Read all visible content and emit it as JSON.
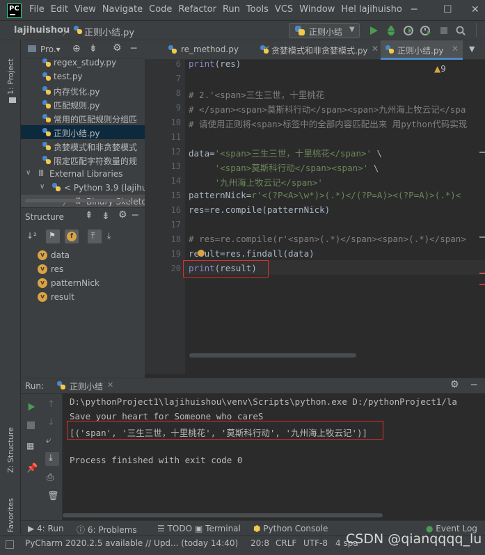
{
  "window": {
    "menu": [
      "File",
      "Edit",
      "View",
      "Navigate",
      "Code",
      "Refactor",
      "Run",
      "Tools",
      "VCS",
      "Window",
      "Hel"
    ],
    "project_title": "lajihuisho"
  },
  "navbar": {
    "project": "lajihuishou",
    "file": "正则小结.py",
    "run_config": "正则小结"
  },
  "left_strip": {
    "project_tab": "1: Project",
    "structure_tab": "Z: Structure",
    "favorites_tab": "2: Favorites"
  },
  "project_panel": {
    "header": "Pro.▾",
    "items": [
      {
        "label": "regex_study.py",
        "indent": 77
      },
      {
        "label": "test.py",
        "indent": 77
      },
      {
        "label": "内存优化.py",
        "indent": 77
      },
      {
        "label": "匹配规则.py",
        "indent": 77
      },
      {
        "label": "常用的匹配规则分组匹",
        "indent": 77
      },
      {
        "label": "正则小结.py",
        "indent": 77,
        "selected": true
      },
      {
        "label": "贪婪模式和非贪婪模式",
        "indent": 77
      },
      {
        "label": "限定匹配字符数量的规",
        "indent": 77
      },
      {
        "label": "External Libraries",
        "indent": 55
      },
      {
        "label": "< Python 3.9 (lajihuis",
        "indent": 75
      },
      {
        "label": "Binary Skeletons",
        "indent": 108
      }
    ]
  },
  "structure_panel": {
    "header": "Structure",
    "items": [
      "data",
      "res",
      "patternNick",
      "result"
    ]
  },
  "editor": {
    "tabs": [
      "re_method.py",
      "贪婪模式和非贪婪模式.py",
      "正则小结.py"
    ],
    "inspection_count": "9",
    "lines": [
      {
        "n": "6",
        "parts": [
          [
            "kw",
            "print"
          ],
          [
            "fn",
            "(res)"
          ]
        ]
      },
      {
        "n": "7",
        "parts": []
      },
      {
        "n": "8",
        "parts": [
          [
            "cm",
            "# 2.'<span>三生三世，十里桃花"
          ]
        ]
      },
      {
        "n": "9",
        "parts": [
          [
            "cm",
            "# </span><span>莫斯科行动</span><span>九州海上牧云记</spa"
          ]
        ]
      },
      {
        "n": "10",
        "parts": [
          [
            "cm",
            "# 请使用正则将<span>标签中的全部内容匹配出来 用python代码实现"
          ]
        ]
      },
      {
        "n": "11",
        "parts": []
      },
      {
        "n": "12",
        "parts": [
          [
            "fn",
            "data="
          ],
          [
            "str",
            "'<span>三生三世，十里桃花</span>'"
          ],
          [
            "fn",
            " \\"
          ]
        ]
      },
      {
        "n": "13",
        "parts": [
          [
            "str",
            "     '<span>莫斯科行动</span><span>'"
          ],
          [
            "fn",
            " \\"
          ]
        ]
      },
      {
        "n": "14",
        "parts": [
          [
            "str",
            "     '九州海上牧云记</span>'"
          ]
        ]
      },
      {
        "n": "15",
        "parts": [
          [
            "fn",
            "patternNick="
          ],
          [
            "str",
            "r'<(?P<A>\\w*)>(.*)</(?P=A)><(?P=A)>(.*)<"
          ]
        ]
      },
      {
        "n": "16",
        "parts": [
          [
            "fn",
            "res=re.compile(patternNick)"
          ]
        ]
      },
      {
        "n": "17",
        "parts": []
      },
      {
        "n": "18",
        "parts": [
          [
            "cm",
            "# res=re.compile(r'<span>(.*)</span><span>(.*)</span>"
          ]
        ]
      },
      {
        "n": "19",
        "parts": [
          [
            "fn",
            "result=res.findall(data)"
          ]
        ]
      },
      {
        "n": "20",
        "parts": [
          [
            "kw",
            "print"
          ],
          [
            "fn",
            "(result)"
          ]
        ]
      }
    ]
  },
  "run_panel": {
    "label": "Run:",
    "tab": "正则小结",
    "output": [
      "D:\\pythonProject1\\lajihuishou\\venv\\Scripts\\python.exe D:/pythonProject1/la",
      "Save your heart for Someone who careS",
      "[('span', '三生三世，十里桃花', '莫斯科行动', '九州海上牧云记')]",
      "",
      "Process finished with exit code 0"
    ]
  },
  "tool_tabs": [
    "4: Run",
    "6: Problems",
    "TODO",
    "Terminal",
    "Python Console",
    "Event Log"
  ],
  "status": {
    "message": "PyCharm 2020.2.5 available // Upd... (today 14:40)",
    "position": "20:8",
    "line_sep": "CRLF",
    "encoding": "UTF-8",
    "indent": "4 spa"
  },
  "watermark": "CSDN @qianqqqq_lu"
}
